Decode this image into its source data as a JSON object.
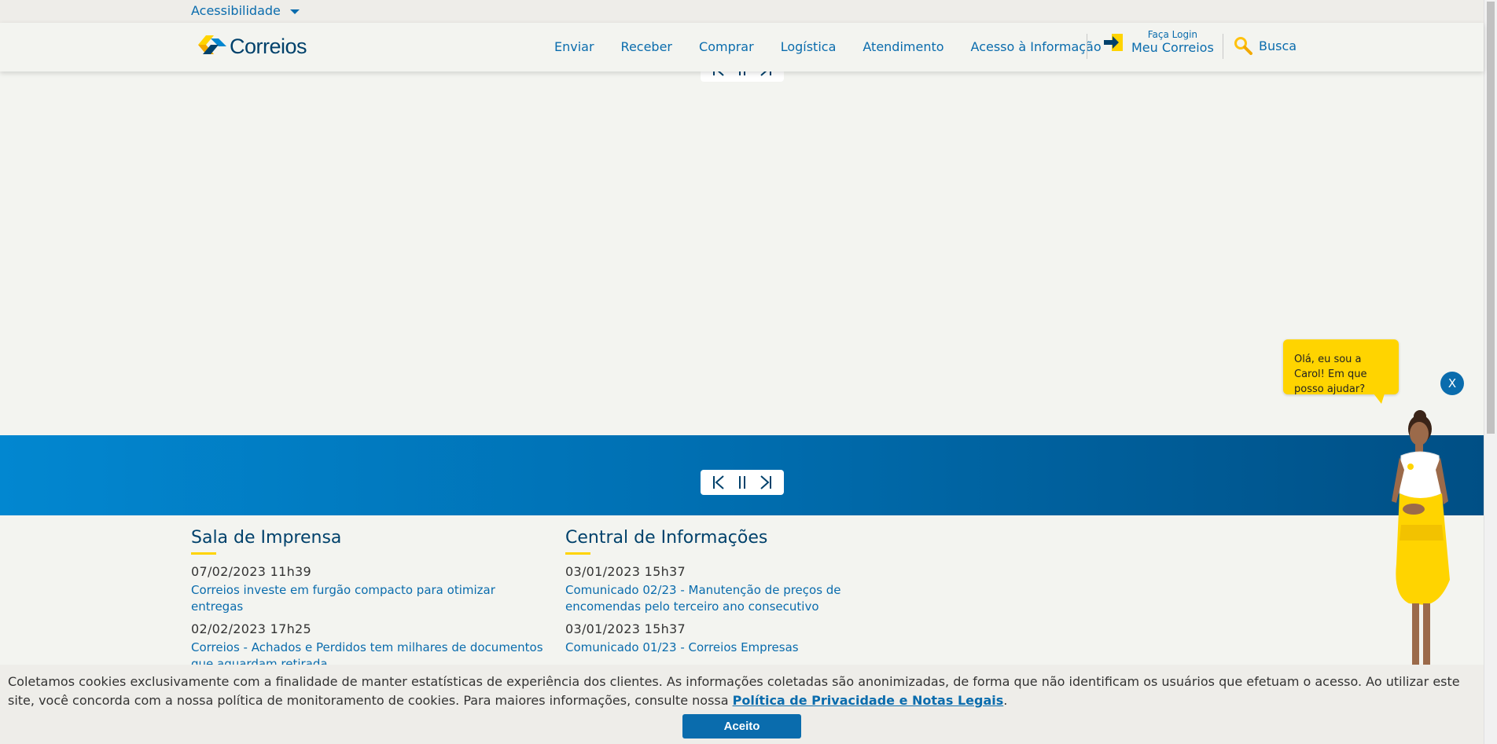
{
  "accessibility": {
    "label": "Acessibilidade"
  },
  "brand": {
    "name": "Correios",
    "colors": {
      "blue": "#0a6cad",
      "navy": "#00416b",
      "yellow": "#ffd400"
    }
  },
  "nav": {
    "items": [
      "Enviar",
      "Receber",
      "Comprar",
      "Logística",
      "Atendimento",
      "Acesso à Informação"
    ]
  },
  "login": {
    "small": "Faça Login",
    "label": "Meu Correios",
    "icon": "login-arrow-icon"
  },
  "search": {
    "label": "Busca",
    "icon": "magnifier-icon"
  },
  "press": {
    "title": "Sala de Imprensa",
    "items": [
      {
        "date": "07/02/2023 11h39",
        "text": "Correios investe em furgão compacto para otimizar entregas"
      },
      {
        "date": "02/02/2023 17h25",
        "text": "Correios - Achados e Perdidos tem milhares de documentos que aguardam retirada"
      }
    ]
  },
  "info": {
    "title": "Central de Informações",
    "items": [
      {
        "date": "03/01/2023 15h37",
        "text": "Comunicado 02/23 - Manutenção de preços de encomendas pelo terceiro ano consecutivo"
      },
      {
        "date": "03/01/2023 15h37",
        "text": "Comunicado 01/23 - Correios Empresas"
      }
    ]
  },
  "assistant": {
    "message": "Olá, eu sou a Carol! Em que posso ajudar?",
    "close": "X"
  },
  "cookie": {
    "text": "Coletamos cookies exclusivamente com a finalidade de manter estatísticas de experiência dos clientes. As informações coletadas são anonimizadas, de forma que não identificam os usuários que efetuam o acesso. Ao utilizar este site, você concorda com a nossa política de monitoramento de cookies. Para maiores informações, consulte nossa ",
    "link": "Política de Privacidade e Notas Legais",
    "end": ".",
    "button": "Aceito"
  }
}
